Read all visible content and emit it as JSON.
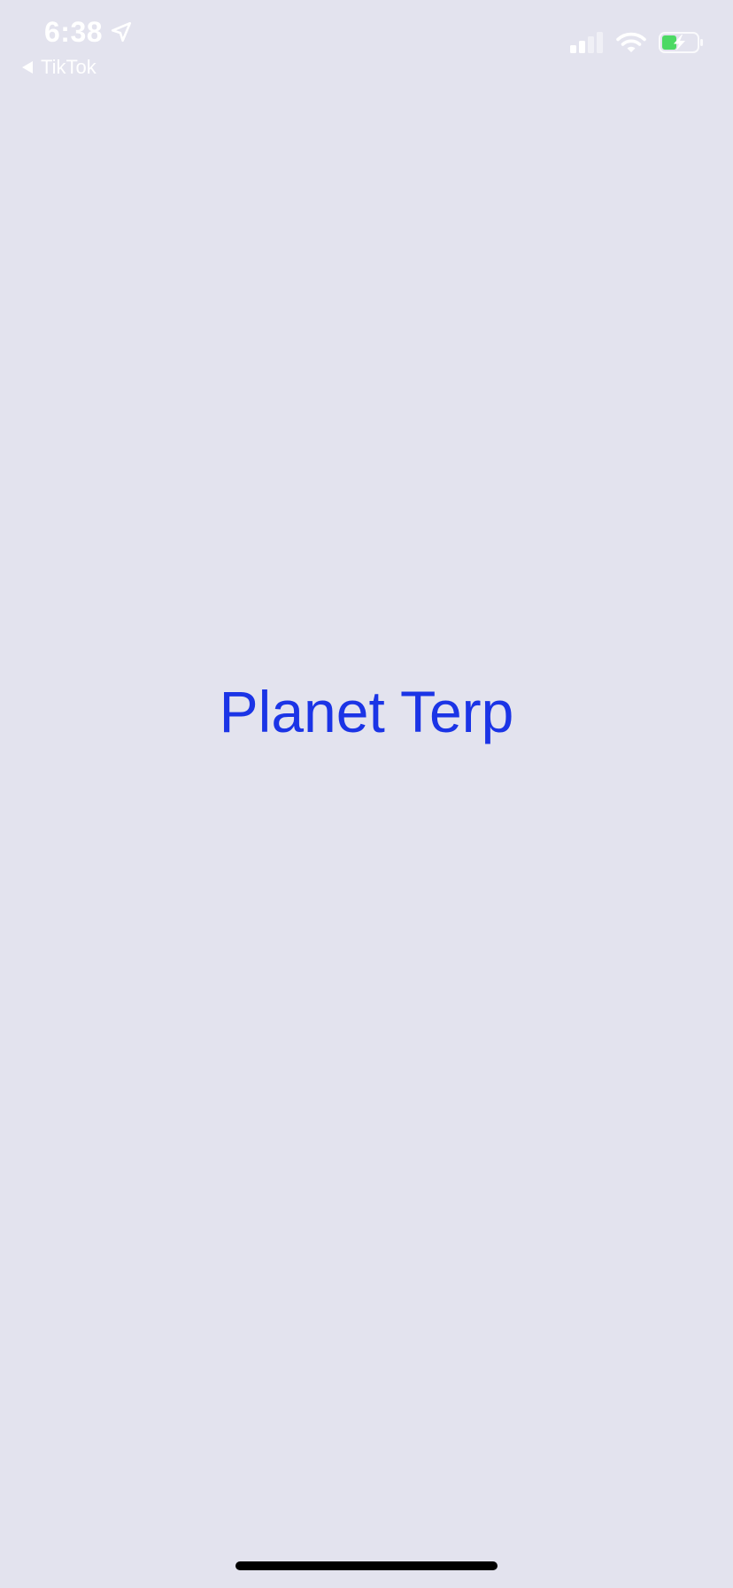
{
  "status_bar": {
    "time": "6:38",
    "back_app": "TikTok",
    "icons": [
      "location-arrow-icon",
      "back-arrow-icon",
      "cellular-signal-icon",
      "wifi-icon",
      "battery-charging-icon"
    ],
    "battery_color": "#4cd964"
  },
  "main": {
    "title": "Planet Terp",
    "title_color": "#1b34e6",
    "background": "#e3e3ee"
  }
}
